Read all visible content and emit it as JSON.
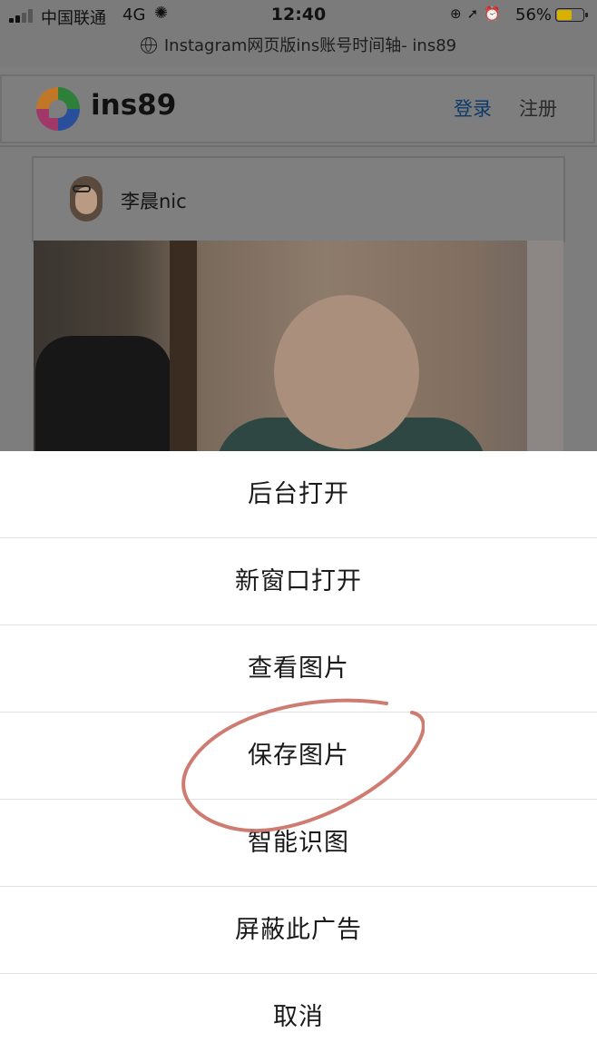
{
  "status_bar": {
    "carrier": "中国联通",
    "network": "4G",
    "time": "12:40",
    "battery_percent": "56%",
    "battery_level": 0.56
  },
  "url_bar": {
    "title": "Instagram网页版ins账号时间轴- ins89"
  },
  "header": {
    "brand": "ins89",
    "login_label": "登录",
    "register_label": "注册",
    "login_color": "#0e3a6a"
  },
  "post": {
    "username": "李晨nic"
  },
  "action_sheet": {
    "items": [
      {
        "label": "后台打开"
      },
      {
        "label": "新窗口打开"
      },
      {
        "label": "查看图片"
      },
      {
        "label": "保存图片"
      },
      {
        "label": "智能识图"
      },
      {
        "label": "屏蔽此广告"
      },
      {
        "label": "取消"
      }
    ],
    "highlight_color": "#c96e62"
  }
}
